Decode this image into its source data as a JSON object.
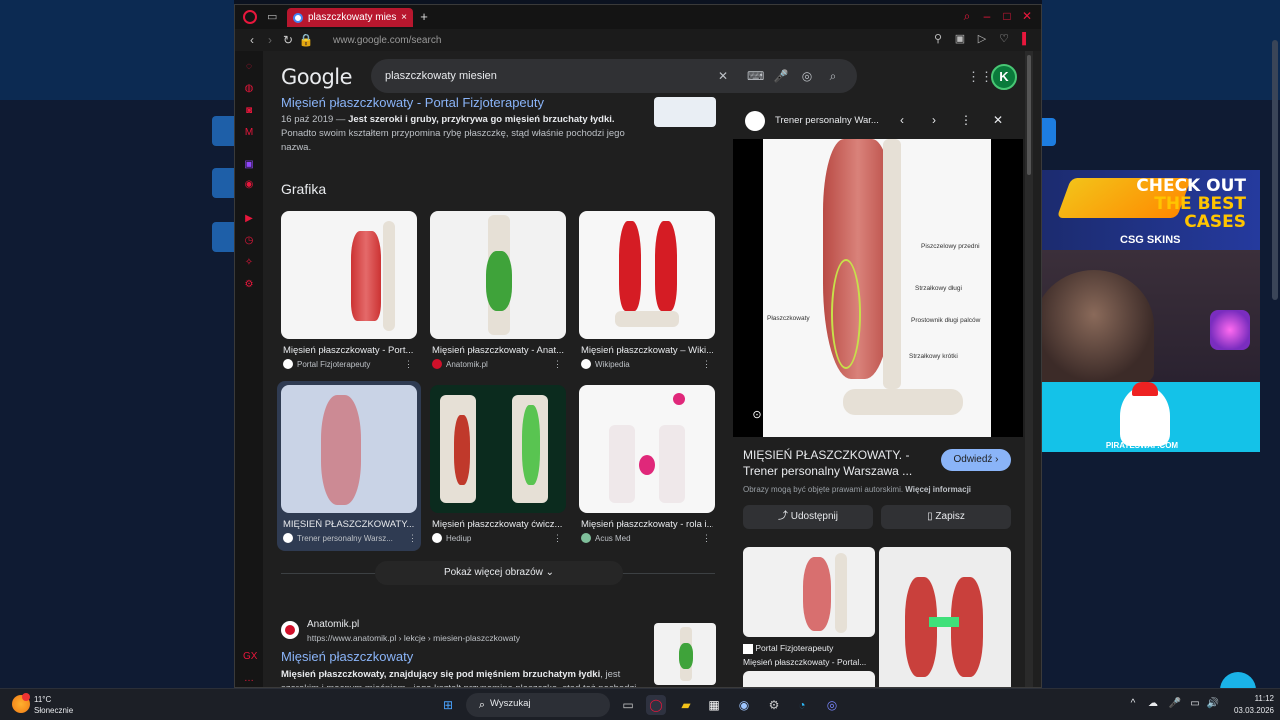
{
  "browser": {
    "tab_title": "plaszczkowaty miesien - S",
    "url": "www.google.com/search"
  },
  "google": {
    "logo": "Google",
    "query": "plaszczkowaty miesien",
    "avatar_letter": "K"
  },
  "results": {
    "first": {
      "title": "Mięsień płaszczkowaty - Portal Fizjoterapeuty",
      "date": "16 paź 2019 — ",
      "snippet_bold": "Jest szeroki i gruby, przykrywa go mięsień brzuchaty łydki.",
      "snippet_rest": " Ponadto swoim kształtem przypomina rybę płaszczkę, stąd właśnie pochodzi jego nazwa."
    },
    "images_heading": "Grafika",
    "images": [
      {
        "caption": "Mięsień płaszczkowaty - Port...",
        "source": "Portal Fizjoterapeuty",
        "src_color": "#ffffff"
      },
      {
        "caption": "Mięsień płaszczkowaty - Anat...",
        "source": "Anatomik.pl",
        "src_color": "#d0102a"
      },
      {
        "caption": "Mięsień płaszczkowaty – Wiki...",
        "source": "Wikipedia",
        "src_color": "#ffffff"
      },
      {
        "caption": "MIĘSIEŃ PŁASZCZKOWATY....",
        "source": "Trener personalny Warsz...",
        "src_color": "#ffffff"
      },
      {
        "caption": "Mięsień płaszczkowaty ćwicz...",
        "source": "Hediup",
        "src_color": "#ffffff"
      },
      {
        "caption": "Mięsień płaszczkowaty - rola i...",
        "source": "Acus Med",
        "src_color": "#7fbf9b"
      }
    ],
    "show_more": "Pokaż więcej obrazów",
    "second": {
      "site": "Anatomik.pl",
      "url": "https://www.anatomik.pl › lekcje › miesien-plaszczkowaty",
      "title": "Mięsień płaszczkowaty",
      "snippet_bold": "Mięsień płaszczkowaty, znajdujący się pod mięśniem brzuchatym łydki",
      "snippet_rest": ", jest szerokim i mocnym mięśniem...jego kształt przypomina płaszczkę, stąd też pochodzi"
    }
  },
  "panel": {
    "site_name": "Trener personalny War...",
    "image_labels": [
      "Piszczelowy przedni",
      "Strzałkowy długi",
      "Płaszczkowaty",
      "Prostownik długi palców",
      "Strzałkowy krótki"
    ],
    "title": "MIĘSIEŃ PŁASZCZKOWATY. - Trener personalny Warszawa ...",
    "visit": "Odwiedź",
    "note_text": "Obrazy mogą być objęte prawami autorskimi. ",
    "note_link": "Więcej informacji",
    "share": "Udostępnij",
    "save": "Zapisz",
    "related_source": "Portal Fizjoterapeuty",
    "related_caption": "Mięsień płaszczkowaty - Portal..."
  },
  "stream": {
    "ad_line1": "CHECK OUT",
    "ad_line2": "THE BEST",
    "ad_line3": "CASES",
    "ad_brand": "CSG SKINS",
    "cam2_site": "PIRATESWAP.COM"
  },
  "taskbar": {
    "temperature": "11°C",
    "weather": "Słonecznie",
    "search_label": "Wyszukaj",
    "time": "11:12",
    "date": "03.03.2026"
  }
}
